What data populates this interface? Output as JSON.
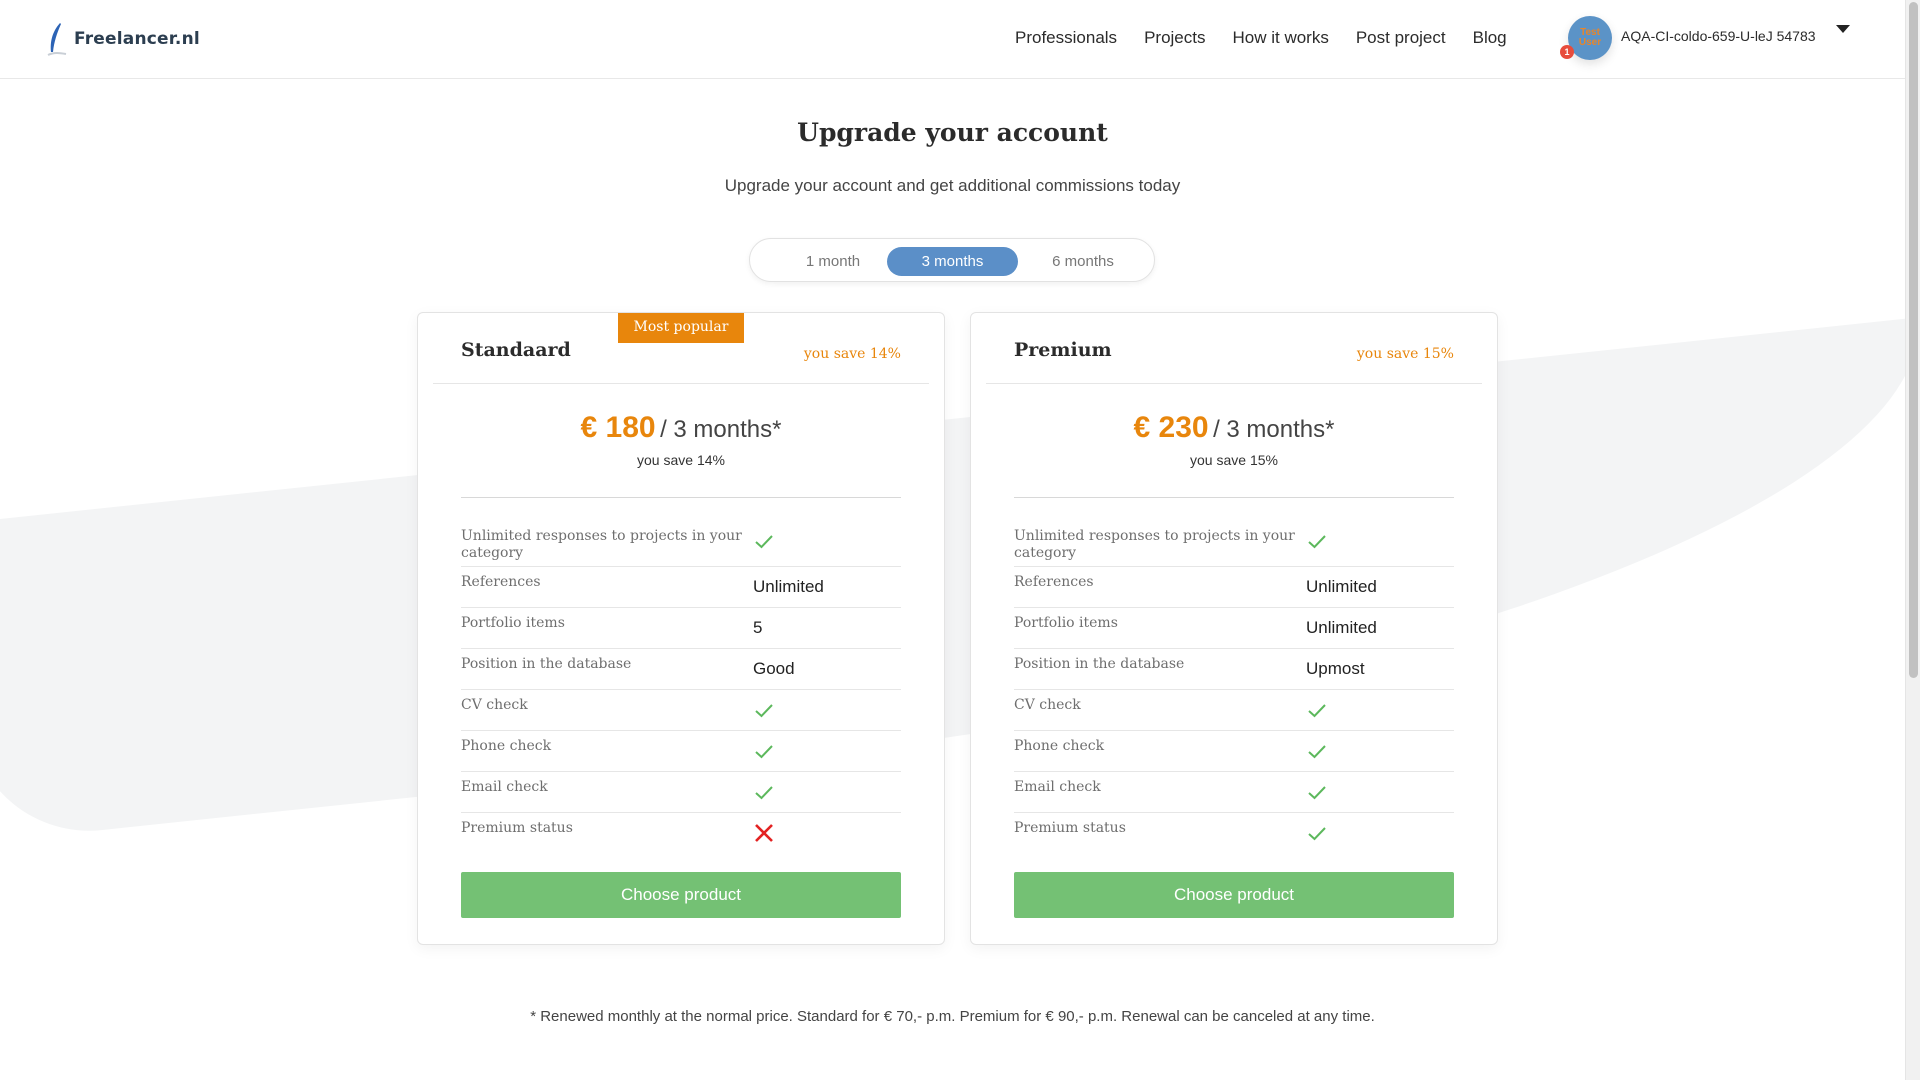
{
  "header": {
    "logo_text": "Freelancer.nl",
    "nav": [
      "Professionals",
      "Projects",
      "How it works",
      "Post project",
      "Blog"
    ],
    "user": {
      "avatar_text_line1": "Test",
      "avatar_text_line2": "User",
      "notification_count": "1",
      "name": "AQA-CI-coldo-659-U-leJ 54783"
    }
  },
  "page": {
    "title": "Upgrade your account",
    "subtitle": "Upgrade your account and get additional commissions today",
    "period_options": [
      "1 month",
      "3 months",
      "6 months"
    ],
    "selected_period": "3 months"
  },
  "plans": [
    {
      "name": "Standaard",
      "badge": "Most popular",
      "save_label": "you save 14%",
      "price": "€ 180",
      "period": "/ 3 months*",
      "price_save": "you save 14%",
      "features": [
        {
          "label": "Unlimited responses to projects in your category",
          "value": "check"
        },
        {
          "label": "References",
          "value": "Unlimited"
        },
        {
          "label": "Portfolio items",
          "value": "5"
        },
        {
          "label": "Position in the database",
          "value": "Good"
        },
        {
          "label": "CV check",
          "value": "check"
        },
        {
          "label": "Phone check",
          "value": "check"
        },
        {
          "label": "Email check",
          "value": "check"
        },
        {
          "label": "Premium status",
          "value": "cross"
        }
      ],
      "button": "Choose product"
    },
    {
      "name": "Premium",
      "badge": "",
      "save_label": "you save 15%",
      "price": "€ 230",
      "period": "/ 3 months*",
      "price_save": "you save 15%",
      "features": [
        {
          "label": "Unlimited responses to projects in your category",
          "value": "check"
        },
        {
          "label": "References",
          "value": "Unlimited"
        },
        {
          "label": "Portfolio items",
          "value": "Unlimited"
        },
        {
          "label": "Position in the database",
          "value": "Upmost"
        },
        {
          "label": "CV check",
          "value": "check"
        },
        {
          "label": "Phone check",
          "value": "check"
        },
        {
          "label": "Email check",
          "value": "check"
        },
        {
          "label": "Premium status",
          "value": "check"
        }
      ],
      "button": "Choose product"
    }
  ],
  "footnote": "* Renewed monthly at the normal price. Standard for € 70,- p.m. Premium for € 90,- p.m. Renewal can be canceled at any time.",
  "colors": {
    "accent_orange": "#e8860c",
    "toggle_active": "#5b8fc8",
    "button_green": "#74c174",
    "check_green": "#5cb85c",
    "cross_red": "#e32222"
  }
}
